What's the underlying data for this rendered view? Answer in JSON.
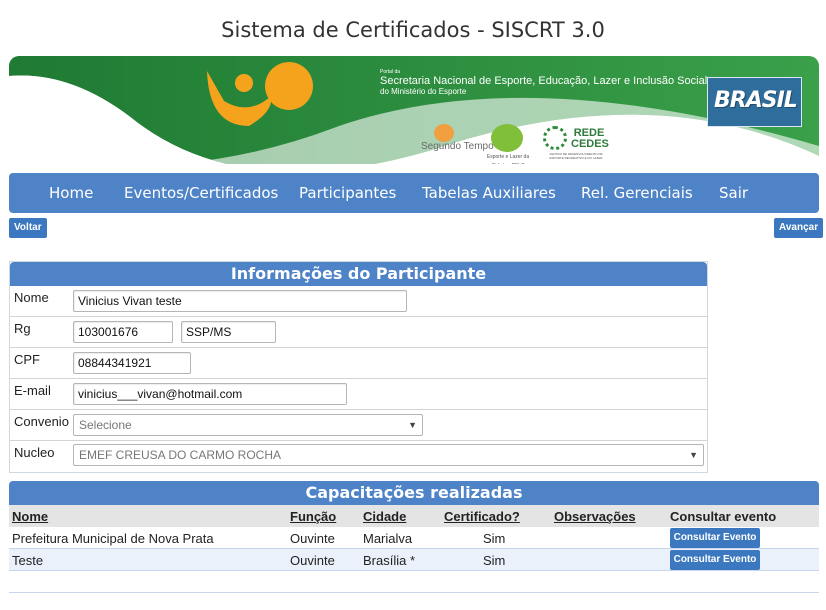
{
  "header": {
    "title": "Sistema de Certificados - SISCRT 3.0"
  },
  "banner": {
    "portal_small": "Portal da",
    "portal_name": "Secretaria Nacional de Esporte, Educação, Lazer e Inclusão Social",
    "portal_sub": "do Ministério do Esporte",
    "logo_segundo_tempo": "Segundo Tempo",
    "logo_pelc": "Esporte e Lazer da Cidade - PELC",
    "logo_rede_cedes": "REDE CEDES",
    "logo_rede_cedes_sub": "CENTRO DE DESENVOLVIMENTO DE ESPORTE RECREATIVO E DO LAZER",
    "logo_brasil": "BRASIL"
  },
  "nav": {
    "items": [
      "Home",
      "Eventos/Certificados",
      "Participantes",
      "Tabelas Auxiliares",
      "Rel. Gerenciais",
      "Sair"
    ]
  },
  "actions": {
    "back_label": "Voltar",
    "next_label": "Avançar"
  },
  "participant": {
    "section_title": "Informações do Participante",
    "name_label": "Nome",
    "name_value": "Vinicius Vivan teste",
    "rg_label": "Rg",
    "rg_value": "103001676",
    "rg_issuer": "SSP/MS",
    "cpf_label": "CPF",
    "cpf_value": "08844341921",
    "email_label": "E-mail",
    "email_value": "vinicius___vivan@hotmail.com",
    "convenio_label": "Convenio",
    "convenio_value": "Selecione",
    "nucleo_label": "Nucleo",
    "nucleo_value": "EMEF CREUSA DO CARMO ROCHA"
  },
  "trainings": {
    "section_title": "Capacitações realizadas",
    "columns": [
      "Nome",
      "Função",
      "Cidade",
      "Certificado?",
      "Observações",
      "Consultar evento"
    ],
    "button_label": "Consultar Evento",
    "rows": [
      {
        "nome": "Prefeitura Municipal de Nova Prata",
        "funcao": "Ouvinte",
        "cidade": "Marialva",
        "certificado": "Sim",
        "observacoes": ""
      },
      {
        "nome": "Teste",
        "funcao": "Ouvinte",
        "cidade": "Brasília *",
        "certificado": "Sim",
        "observacoes": ""
      }
    ]
  },
  "colors": {
    "accent": "#4f83c8",
    "banner_green": "#2e8b3a",
    "button": "#3c78bf"
  }
}
